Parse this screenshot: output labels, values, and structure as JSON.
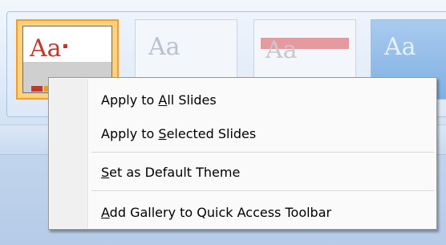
{
  "gallery": {
    "themes": [
      {
        "name": "office-theme",
        "sample_text": "Aa",
        "selected": true
      },
      {
        "name": "plain-theme",
        "sample_text": "Aa",
        "selected": false
      },
      {
        "name": "red-band-theme",
        "sample_text": "Aa",
        "selected": false
      },
      {
        "name": "blue-theme",
        "sample_text": "Aa",
        "selected": false
      }
    ]
  },
  "context_menu": {
    "items": [
      {
        "before": "Apply to ",
        "accel": "A",
        "after": "ll Slides"
      },
      {
        "before": "Apply to ",
        "accel": "S",
        "after": "elected Slides"
      },
      {
        "before": "",
        "accel": "S",
        "after": "et as Default Theme"
      },
      {
        "before": "",
        "accel": "A",
        "after": "dd Gallery to Quick Access Toolbar"
      }
    ]
  },
  "colors": {
    "selection_border": "#ef9d32",
    "menu_background": "#fafafa",
    "menu_border": "#979797"
  }
}
